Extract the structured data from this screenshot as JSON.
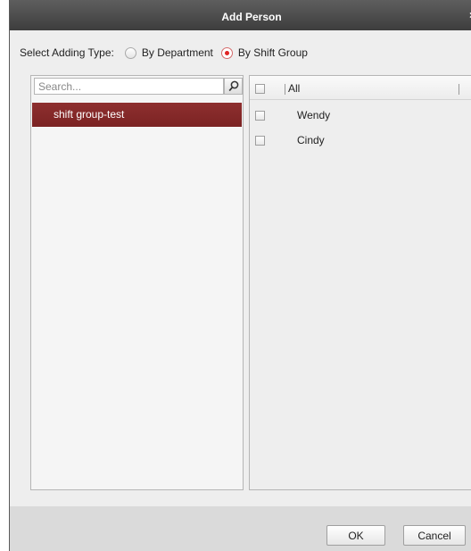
{
  "dialog": {
    "title": "Add Person",
    "close_glyph": "×"
  },
  "adding_type": {
    "label": "Select Adding Type:",
    "options": [
      {
        "label": "By Department",
        "checked": false
      },
      {
        "label": "By Shift Group",
        "checked": true
      }
    ]
  },
  "left_panel": {
    "search_placeholder": "Search...",
    "search_icon": "search-icon",
    "groups": [
      {
        "label": "shift group-test",
        "selected": true
      }
    ]
  },
  "right_panel": {
    "header_label": "All",
    "persons": [
      {
        "name": "Wendy",
        "checked": false
      },
      {
        "name": "Cindy",
        "checked": false
      }
    ]
  },
  "footer": {
    "ok_label": "OK",
    "cancel_label": "Cancel"
  },
  "colors": {
    "titlebar": "#4a4a4a",
    "selected_row": "#862a2a",
    "radio_checked": "#e02424"
  }
}
